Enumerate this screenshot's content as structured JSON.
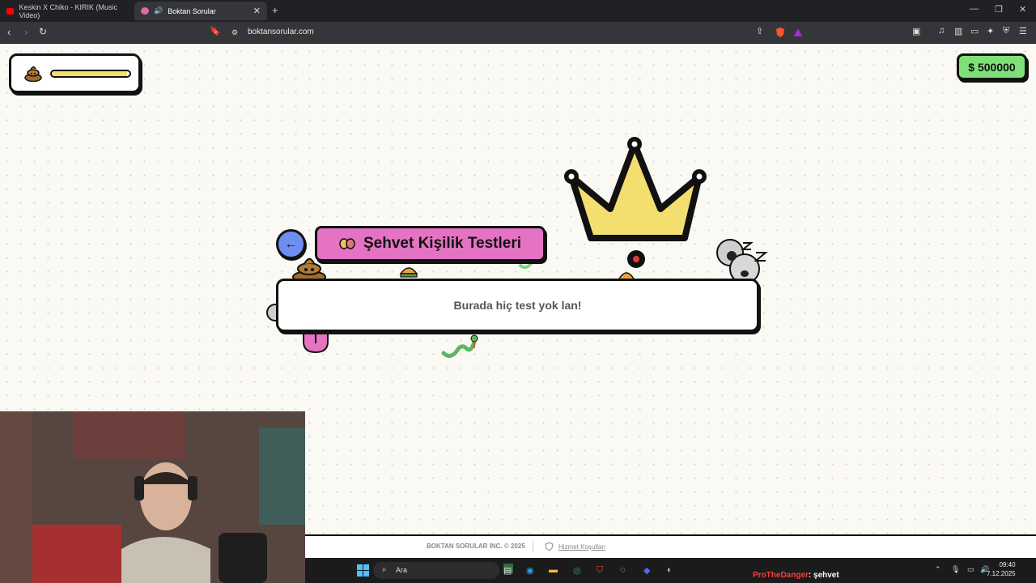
{
  "browser": {
    "tabs": [
      {
        "title": "Keskin X Chiko - KIRIK (Music Video)",
        "active": false
      },
      {
        "title": "Boktan Sorular",
        "active": true
      }
    ],
    "new_tab": "+",
    "url": "boktansorular.com",
    "window_controls": {
      "minimize": "—",
      "restore": "❐",
      "close": "✕"
    }
  },
  "page": {
    "money": "$ 500000",
    "progress_fraction": 0.97,
    "back_icon": "←",
    "category_title": "Şehvet Kişilik Testleri",
    "empty_message": "Burada hiç test yok lan!",
    "footer": {
      "copyright": "BOKTAN SORULAR INC. © 2025",
      "terms": "Hizmet Koşulları"
    }
  },
  "taskbar": {
    "search_placeholder": "Ara",
    "time": "09:40",
    "date": "7.12.2025"
  },
  "chat": {
    "user": "ProTheDanger",
    "message": ": şehvet"
  },
  "colors": {
    "accent_pink": "#e573c4",
    "money_green": "#7fe07a",
    "back_blue": "#6d8ff0",
    "progress_yellow": "#f2df6f",
    "crown_yellow": "#f2df6f"
  }
}
